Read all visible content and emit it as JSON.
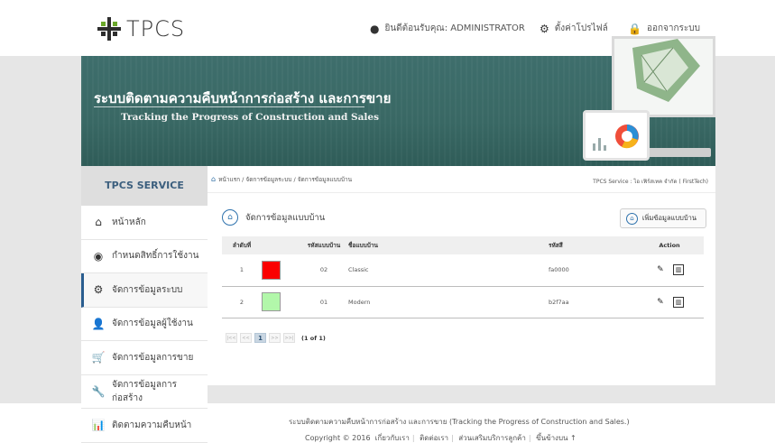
{
  "brand": {
    "name": "TPCS"
  },
  "topbar": {
    "welcome": "ยินดีต้อนรับคุณ: ADMINISTRATOR",
    "profile": "ตั้งค่าโปรไฟล์",
    "logout": "ออกจากระบบ"
  },
  "banner": {
    "title_th": "ระบบติดตามความคืบหน้าการก่อสร้าง และการขาย",
    "title_en": "Tracking the Progress of Construction and Sales"
  },
  "sidebar": {
    "header": "TPCS SERVICE",
    "items": [
      {
        "label": "หน้าหลัก",
        "icon": "home-icon",
        "glyph": "⌂"
      },
      {
        "label": "กำหนดสิทธิ์การใช้งาน",
        "icon": "eye-icon",
        "glyph": "◉"
      },
      {
        "label": "จัดการข้อมูลระบบ",
        "icon": "cogs-icon",
        "glyph": "⚙"
      },
      {
        "label": "จัดการข้อมูลผู้ใช้งาน",
        "icon": "user-icon",
        "glyph": "👤"
      },
      {
        "label": "จัดการข้อมูลการขาย",
        "icon": "cart-icon",
        "glyph": "🛒"
      },
      {
        "label": "จัดการข้อมูลการก่อสร้าง",
        "icon": "wrench-icon",
        "glyph": "🔧"
      },
      {
        "label": "ติดตามความคืบหน้า",
        "icon": "chart-icon",
        "glyph": "📊"
      }
    ],
    "active_index": 2
  },
  "breadcrumb": {
    "home": "หน้าแรก",
    "system": "จัดการข้อมูลระบบ",
    "current": "จัดการข้อมูลแบบบ้าน",
    "company": "TPCS Service : ไอ เฟิร์สเทค จำกัด ( FirstTech)"
  },
  "page": {
    "title": "จัดการข้อมูลแบบบ้าน",
    "add_button": "เพิ่มข้อมูลแบบบ้าน"
  },
  "table": {
    "headers": {
      "no": "ลำดับที่",
      "code": "รหัสแบบบ้าน",
      "name": "ชื่อแบบบ้าน",
      "color": "รหัสสี",
      "action": "Action"
    },
    "rows": [
      {
        "no": "1",
        "code": "02",
        "name": "Classic",
        "hex": "fa0000",
        "swatch": "#fa0000"
      },
      {
        "no": "2",
        "code": "01",
        "name": "Modern",
        "hex": "b2f7aa",
        "swatch": "#b2f7aa"
      }
    ]
  },
  "pager": {
    "first": "|<<",
    "prev": "<<",
    "current": "1",
    "next": ">>",
    "last": ">>|",
    "info": "(1 of 1)"
  },
  "footer": {
    "line1": "ระบบติดตามความคืบหน้าการก่อสร้าง และการขาย  (Tracking the Progress of Construction and Sales.)",
    "copyright": "Copyright © 2016",
    "links": [
      "เกี่ยวกับเรา",
      "ติดต่อเรา",
      "ส่วนเสริมบริการลูกค้า",
      "ขึ้นข้างบน ↑"
    ]
  }
}
